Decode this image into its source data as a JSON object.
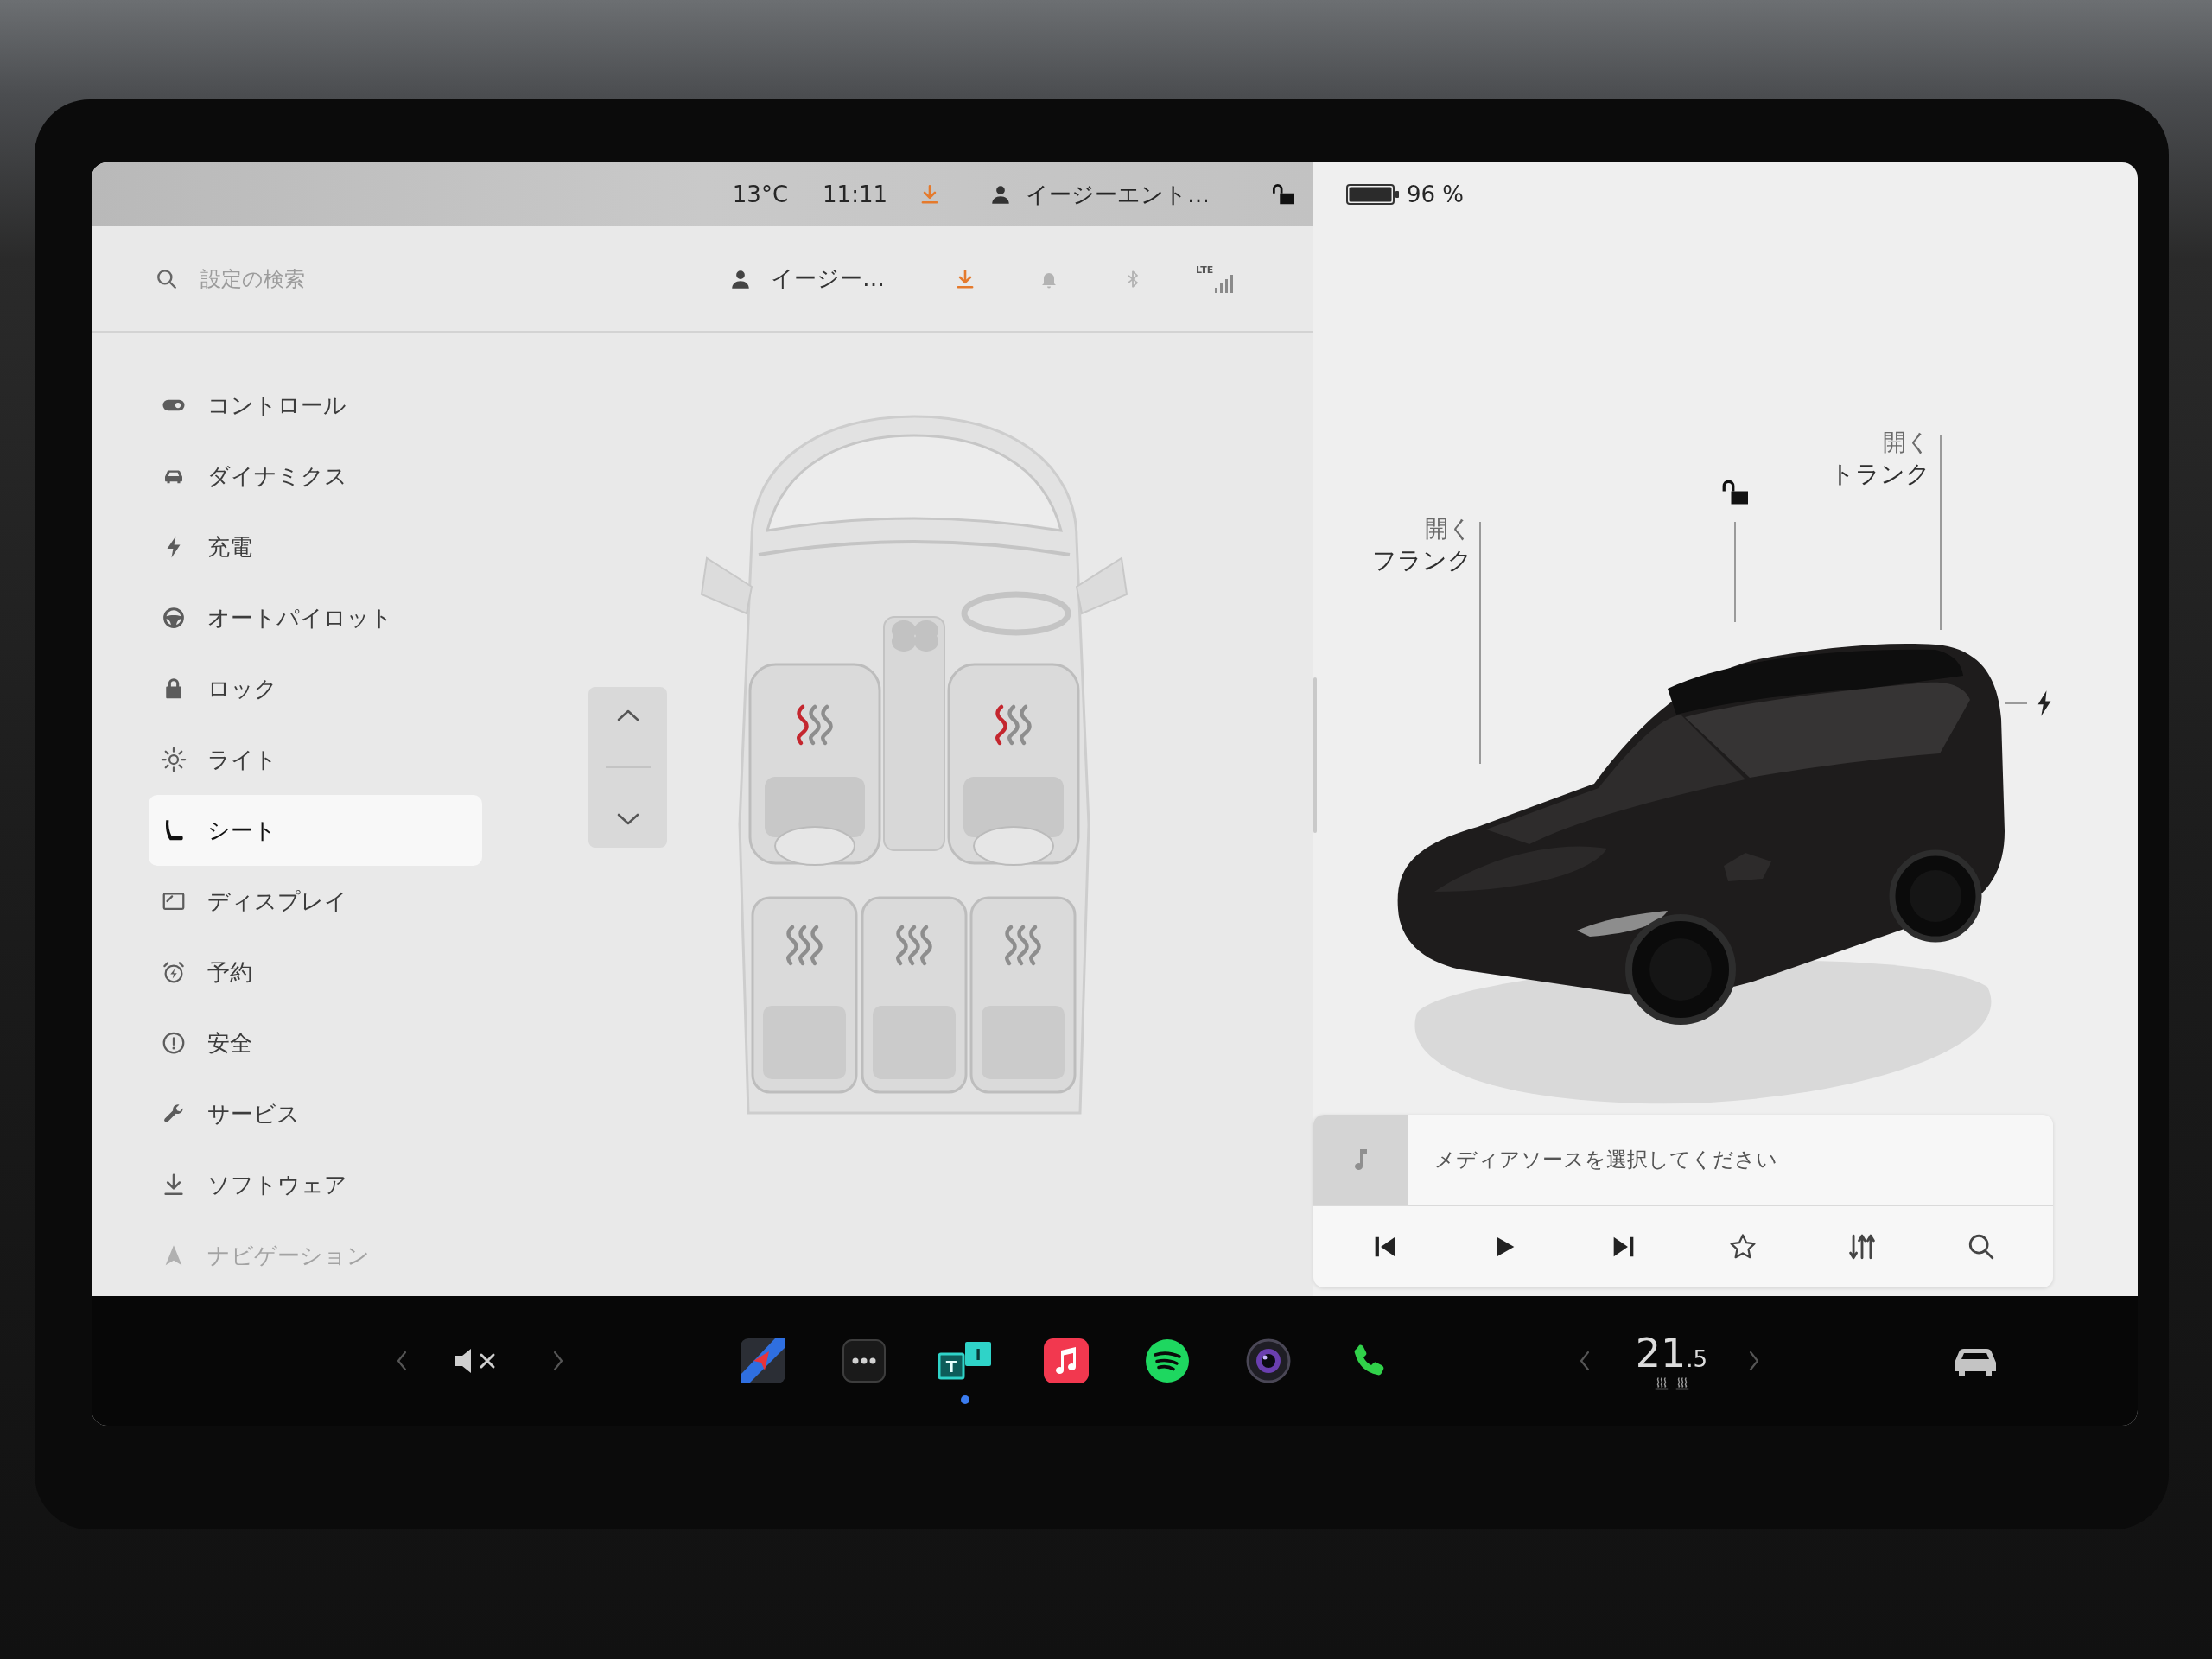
{
  "status_bar": {
    "temperature": "13°C",
    "time": "11:11",
    "profile": "イージーエント…",
    "locked": false,
    "battery": "96 %"
  },
  "settings": {
    "search": {
      "placeholder": "設定の検索"
    },
    "profile": "イージー…",
    "network": "LTE",
    "sidebar": {
      "items": [
        {
          "label": "コントロール",
          "selected": false
        },
        {
          "label": "ダイナミクス",
          "selected": false
        },
        {
          "label": "充電",
          "selected": false
        },
        {
          "label": "オートパイロット",
          "selected": false
        },
        {
          "label": "ロック",
          "selected": false
        },
        {
          "label": "ライト",
          "selected": false
        },
        {
          "label": "シート",
          "selected": true
        },
        {
          "label": "ディスプレイ",
          "selected": false
        },
        {
          "label": "予約",
          "selected": false
        },
        {
          "label": "安全",
          "selected": false
        },
        {
          "label": "サービス",
          "selected": false
        },
        {
          "label": "ソフトウェア",
          "selected": false
        },
        {
          "label": "ナビゲーション",
          "selected": false
        }
      ]
    }
  },
  "seats": {
    "front": [
      {
        "heated": true
      },
      {
        "heated": true
      }
    ],
    "rear": [
      {
        "heated": false
      },
      {
        "heated": false
      },
      {
        "heated": false
      }
    ]
  },
  "vehicle": {
    "frunk": {
      "action": "開く",
      "label": "フランク"
    },
    "locked": false,
    "trunk": {
      "action": "開く",
      "label": "トランク"
    }
  },
  "media": {
    "prompt": "メディアソースを選択してください"
  },
  "dock": {
    "volume_muted": true,
    "apps": [
      {
        "kind": "navigation",
        "active": false
      },
      {
        "kind": "more",
        "active": false
      },
      {
        "kind": "toybox",
        "letters": [
          "T",
          "I"
        ],
        "active": true
      },
      {
        "kind": "music",
        "active": false
      },
      {
        "kind": "spotify",
        "active": false
      },
      {
        "kind": "camera",
        "active": false
      },
      {
        "kind": "phone",
        "active": false
      }
    ],
    "temperature": {
      "whole": "21",
      "decimal": ".5"
    }
  }
}
